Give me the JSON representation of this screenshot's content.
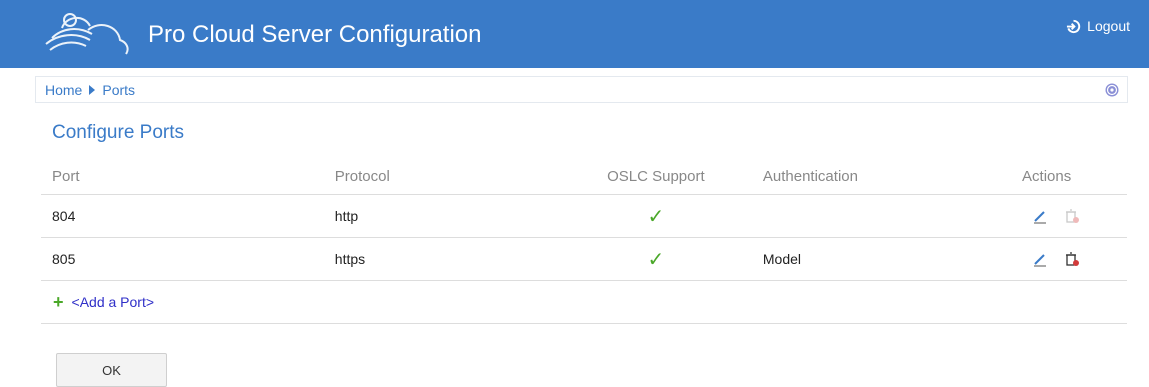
{
  "header": {
    "title": "Pro Cloud Server Configuration",
    "logout_label": "Logout",
    "bg_color": "#3a7bc8"
  },
  "breadcrumb": {
    "items": [
      "Home",
      "Ports"
    ]
  },
  "page": {
    "title": "Configure Ports"
  },
  "table": {
    "columns": [
      "Port",
      "Protocol",
      "OSLC Support",
      "Authentication",
      "Actions"
    ],
    "rows": [
      {
        "port": "804",
        "protocol": "http",
        "oslc": "✓",
        "authentication": "",
        "delete_enabled": false
      },
      {
        "port": "805",
        "protocol": "https",
        "oslc": "✓",
        "authentication": "Model",
        "delete_enabled": true
      }
    ]
  },
  "add_port": {
    "icon": "+",
    "label": "<Add a Port>"
  },
  "buttons": {
    "ok_label": "OK"
  },
  "icons": {
    "logo": "cloud-logo-icon",
    "logout": "logout-icon",
    "help": "help-icon",
    "edit": "pencil-icon",
    "delete": "trash-icon",
    "check": "checkmark-icon",
    "add": "plus-icon"
  }
}
